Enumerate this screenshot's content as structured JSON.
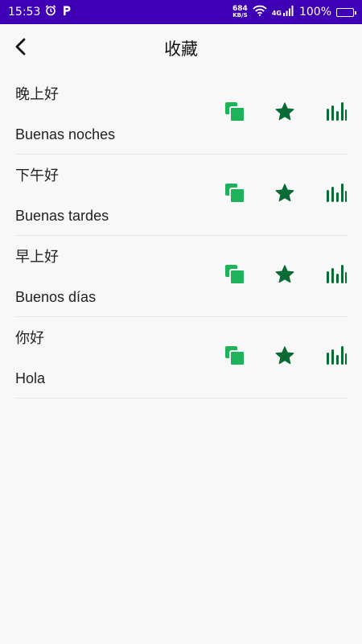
{
  "status_bar": {
    "time": "15:53",
    "net_speed_value": "684",
    "net_speed_unit": "KB/S",
    "network_type": "4G",
    "battery": "100%"
  },
  "header": {
    "title": "收藏"
  },
  "favorites": [
    {
      "chinese": "晚上好",
      "spanish": "Buenas noches"
    },
    {
      "chinese": "下午好",
      "spanish": "Buenas tardes"
    },
    {
      "chinese": "早上好",
      "spanish": "Buenos días"
    },
    {
      "chinese": "你好",
      "spanish": "Hola"
    }
  ],
  "colors": {
    "status_bar": "#3f00b5",
    "copy_icon": "#1db35a",
    "star_icon": "#0a6b34",
    "sound_icon": "#0a6b34"
  }
}
